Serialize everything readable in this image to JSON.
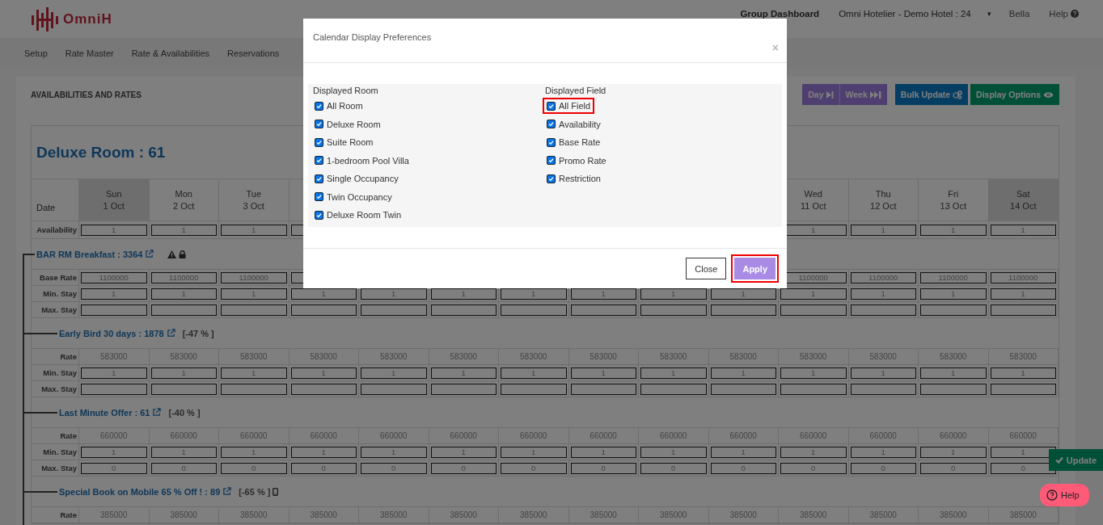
{
  "header": {
    "logo": "OmniH",
    "group_dashboard": "Group Dashboard",
    "hotel": "Omni Hotelier - Demo Hotel : 24",
    "caret": "▾",
    "user": "Bella",
    "help": "Help"
  },
  "nav": [
    "Setup",
    "Rate Master",
    "Rate & Availabilities",
    "Reservations"
  ],
  "page": {
    "title": "AVAILABILITIES AND RATES",
    "buttons": [
      {
        "label": "Day",
        "kind": "day"
      },
      {
        "label": "Week",
        "kind": "week"
      },
      {
        "label": "Bulk Update",
        "kind": "bulk"
      },
      {
        "label": "Display Options",
        "kind": "display"
      }
    ]
  },
  "calendar": {
    "room_title": "Deluxe Room : 61",
    "date_label": "Date",
    "availability_label": "Availability",
    "days": [
      {
        "day": "Sun",
        "date": "1 Oct",
        "weekend": true
      },
      {
        "day": "Mon",
        "date": "2 Oct",
        "weekend": false
      },
      {
        "day": "Tue",
        "date": "3 Oct",
        "weekend": false
      }
    ],
    "days_end": [
      {
        "day": "Wed",
        "date": "11 Oct",
        "weekend": false
      },
      {
        "day": "Thu",
        "date": "12 Oct",
        "weekend": false
      },
      {
        "day": "Fri",
        "date": "13 Oct",
        "weekend": false
      },
      {
        "day": "Sat",
        "date": "14 Oct",
        "weekend": true
      }
    ],
    "availability": [
      "1",
      "1",
      "1"
    ],
    "availability_end": [
      "1",
      "1",
      "1",
      "1"
    ],
    "rate_plans": [
      {
        "name": "BAR RM Breakfast : 3364",
        "warning": true,
        "locked": true,
        "mobile": false,
        "rows": [
          {
            "label": "Base Rate",
            "kind": "input",
            "values": [
              "1100000",
              "1100000",
              "1100000"
            ],
            "values_end": [
              "1100000",
              "1100000",
              "1100000",
              "1100000"
            ]
          },
          {
            "label": "Min. Stay",
            "kind": "input",
            "values": [
              "1",
              "1",
              "1",
              "1",
              "1",
              "1",
              "1",
              "1",
              "1",
              "1",
              "1",
              "1",
              "1",
              "1"
            ]
          },
          {
            "label": "Max. Stay",
            "kind": "input"
          }
        ],
        "children": [
          {
            "name": "Early Bird 30 days : 1878",
            "discount": "[-47 % ]",
            "warning": false,
            "locked": false,
            "mobile": false,
            "rows": [
              {
                "label": "Rate",
                "kind": "text",
                "values": [
                  "583000",
                  "583000",
                  "583000",
                  "583000",
                  "583000",
                  "583000",
                  "583000",
                  "583000",
                  "583000",
                  "583000",
                  "583000",
                  "583000",
                  "583000",
                  "583000"
                ]
              },
              {
                "label": "Min. Stay",
                "kind": "input",
                "values": [
                  "1",
                  "1",
                  "1",
                  "1",
                  "1",
                  "1",
                  "1",
                  "1",
                  "1",
                  "1",
                  "1",
                  "1",
                  "1",
                  "1"
                ]
              },
              {
                "label": "Max. Stay",
                "kind": "input"
              }
            ]
          },
          {
            "name": "Last Minute Offer : 61",
            "discount": "[-40 % ]",
            "warning": false,
            "locked": false,
            "mobile": false,
            "rows": [
              {
                "label": "Rate",
                "kind": "text",
                "values": [
                  "660000",
                  "660000",
                  "660000",
                  "660000",
                  "660000",
                  "660000",
                  "660000",
                  "660000",
                  "660000",
                  "660000",
                  "660000",
                  "660000",
                  "660000",
                  "660000"
                ]
              },
              {
                "label": "Min. Stay",
                "kind": "input",
                "values": [
                  "1",
                  "1",
                  "1",
                  "1",
                  "1",
                  "1",
                  "1",
                  "1",
                  "1",
                  "1",
                  "1",
                  "1",
                  "1",
                  "1"
                ]
              },
              {
                "label": "Max. Stay",
                "kind": "input",
                "values": [
                  "0",
                  "0",
                  "0",
                  "0",
                  "0",
                  "0",
                  "0",
                  "0",
                  "0",
                  "0",
                  "0",
                  "0",
                  "0",
                  "0"
                ]
              }
            ]
          },
          {
            "name": "Special Book on Mobile 65 % Off ! : 89",
            "discount": "[-65 % ]",
            "warning": false,
            "locked": false,
            "mobile": true,
            "rows": [
              {
                "label": "Rate",
                "kind": "text",
                "values": [
                  "385000",
                  "385000",
                  "385000",
                  "385000",
                  "385000",
                  "385000",
                  "385000",
                  "385000",
                  "385000",
                  "385000",
                  "385000",
                  "385000",
                  "385000",
                  "385000"
                ]
              }
            ]
          }
        ]
      }
    ]
  },
  "update_button": "Update",
  "help_button": "Help",
  "modal": {
    "title": "Calendar Display Preferences",
    "close": "×",
    "columns": [
      {
        "heading": "Displayed Room",
        "options": [
          {
            "label": "All Room",
            "checked": true,
            "highlighted": false
          },
          {
            "label": "Deluxe Room",
            "checked": true,
            "highlighted": false
          },
          {
            "label": "Suite Room",
            "checked": true,
            "highlighted": false
          },
          {
            "label": "1-bedroom Pool Villa",
            "checked": true,
            "highlighted": false
          },
          {
            "label": "Single Occupancy",
            "checked": true,
            "highlighted": false
          },
          {
            "label": "Twin Occupancy",
            "checked": true,
            "highlighted": false
          },
          {
            "label": "Deluxe Room Twin",
            "checked": true,
            "highlighted": false
          }
        ]
      },
      {
        "heading": "Displayed Field",
        "options": [
          {
            "label": "All Field",
            "checked": true,
            "highlighted": true
          },
          {
            "label": "Availability",
            "checked": true,
            "highlighted": false
          },
          {
            "label": "Base Rate",
            "checked": true,
            "highlighted": false
          },
          {
            "label": "Promo Rate",
            "checked": true,
            "highlighted": false
          },
          {
            "label": "Restriction",
            "checked": true,
            "highlighted": false
          }
        ]
      }
    ],
    "buttons": [
      {
        "label": "Close",
        "kind": "secondary",
        "highlighted": false
      },
      {
        "label": "Apply",
        "kind": "primary",
        "highlighted": true
      }
    ]
  }
}
